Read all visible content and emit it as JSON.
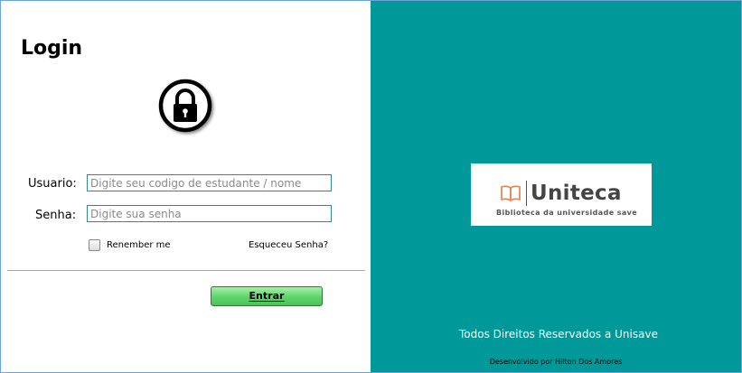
{
  "login": {
    "title": "Login",
    "user_label": "Usuario:",
    "user_placeholder": "Digite seu codigo de estudante / nome",
    "pass_label": "Senha:",
    "pass_placeholder": "Digite sua senha",
    "remember_label": "Renember me",
    "forgot_label": "Esqueceu Senha?",
    "enter_label": "Entrar",
    "remember_checked": false
  },
  "brand": {
    "name": "Uniteca",
    "tagline": "Biblioteca da universidade save",
    "icon": "open-book-icon",
    "icon_color": "#e8885a",
    "panel_color": "#009898"
  },
  "footer": {
    "rights": "Todos Direitos Reservados a Unisave",
    "developer": "Desenvolvido por Hilton Dos Amores"
  },
  "icons": {
    "lock": "padlock-icon"
  }
}
